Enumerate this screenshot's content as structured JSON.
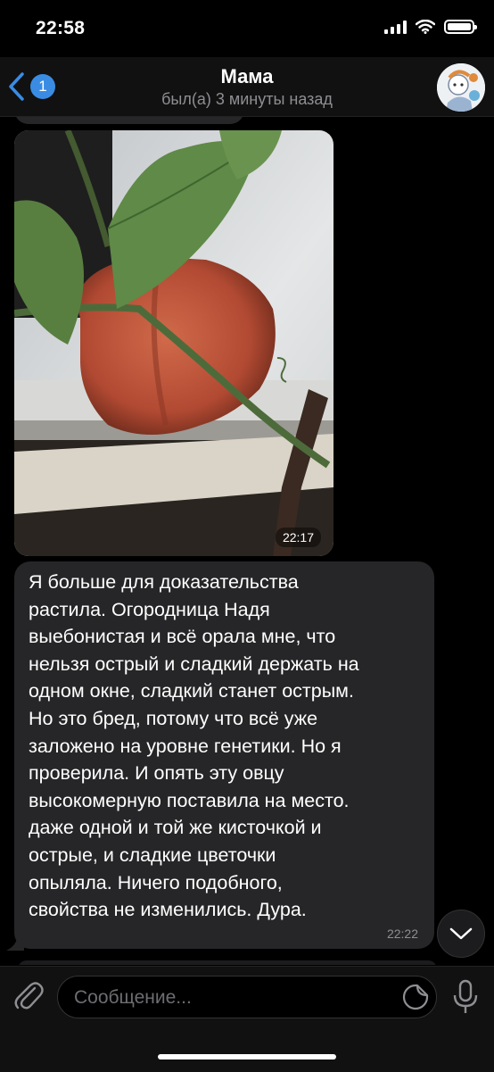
{
  "status_bar": {
    "time": "22:58"
  },
  "header": {
    "back_badge": "1",
    "title": "Мама",
    "status": "был(а) 3 минуты назад"
  },
  "messages": {
    "photo": {
      "time": "22:17"
    },
    "text": {
      "body": "Я больше для доказательства\nрастила. Огородница Надя\nвыебонистая и всё орала мне, что\nнельзя острый и сладкий держать на\nодном окне, сладкий станет острым.\nНо это бред, потому что всё уже\nзаложено на уровне генетики. Но я\nпроверила. И опять эту овцу\nвысокомерную поставила на место.\nдаже одной и той же кисточкой и\nострые, и сладкие цветочки\nопыляла. Ничего подобного,\nсвойства не изменились. Дура.",
      "time": "22:22"
    }
  },
  "input": {
    "placeholder": "Сообщение..."
  },
  "colors": {
    "accent": "#3a8ce3",
    "bubble": "#262628",
    "background": "#000000",
    "secondary_text": "#8e8e93"
  },
  "icons": [
    "wifi-icon",
    "signal-icon",
    "battery-icon",
    "back-chevron-icon",
    "paperclip-icon",
    "sticker-icon",
    "microphone-icon",
    "chevron-down-icon"
  ]
}
